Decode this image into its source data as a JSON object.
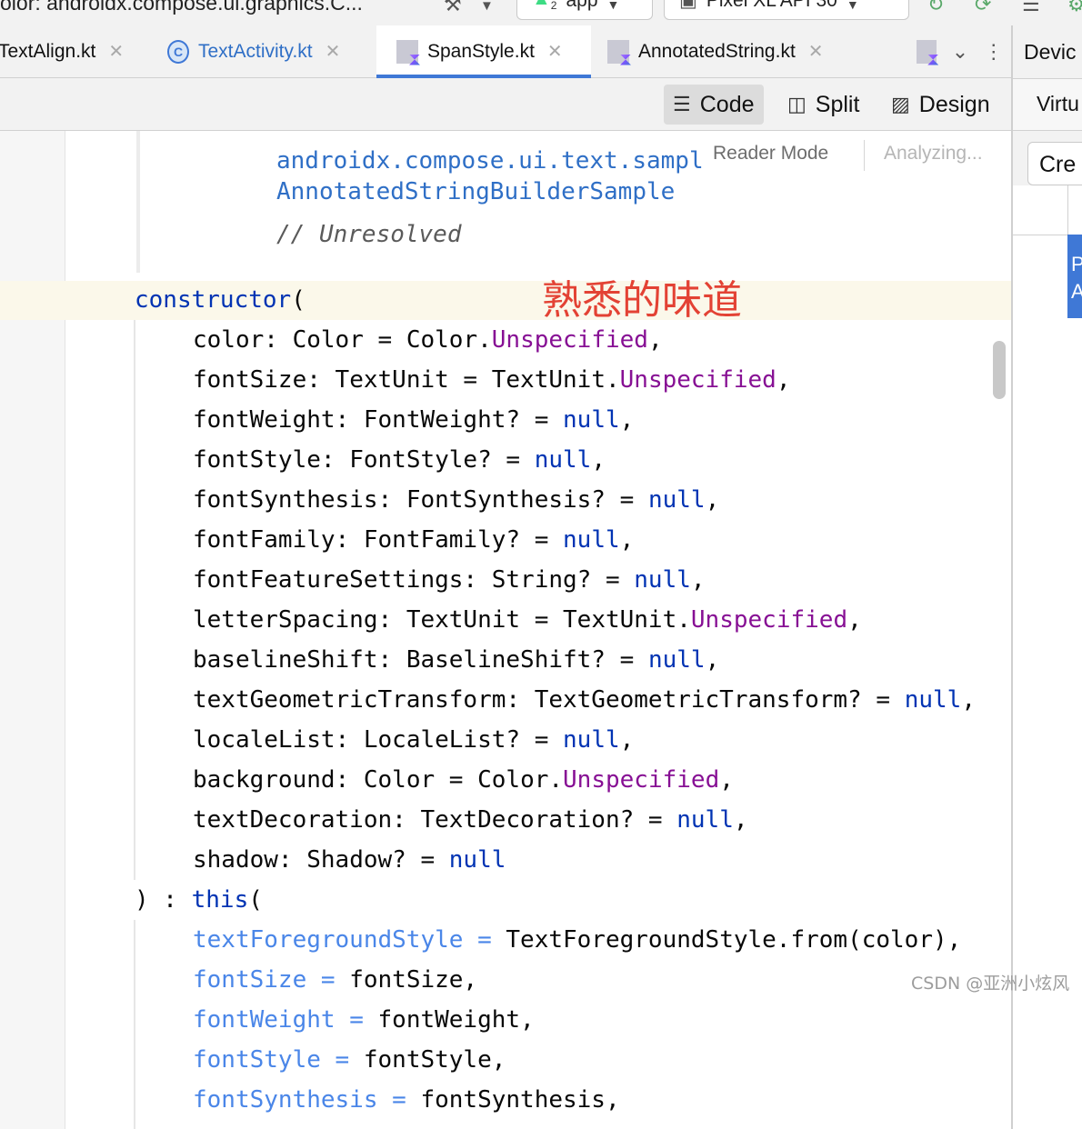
{
  "toolbar": {
    "breadcrumb": "olor: androidx.compose.ui.graphics.C...",
    "run_config": "app",
    "device": "Pixel XL API 30",
    "badge_count": "2"
  },
  "tabs": [
    {
      "label": "TextAlign.kt",
      "type": "kotlin-file",
      "active": false
    },
    {
      "label": "TextActivity.kt",
      "type": "kotlin-class",
      "active": false
    },
    {
      "label": "SpanStyle.kt",
      "type": "kotlin-file",
      "active": true
    },
    {
      "label": "AnnotatedString.kt",
      "type": "kotlin-file",
      "active": false
    }
  ],
  "view_modes": {
    "code": "Code",
    "split": "Split",
    "design": "Design"
  },
  "right_panel": {
    "title": "Devic",
    "subtitle": "Virtu",
    "create": "Cre",
    "device_letters": [
      "P",
      "A"
    ]
  },
  "editor": {
    "reader_mode": "Reader Mode",
    "analyzing": "Analyzing...",
    "doc_link_1": "androidx.compose.ui.text.sampl",
    "doc_link_2": "AnnotatedStringBuilderSample",
    "doc_comment": "// Unresolved",
    "annotation": "熟悉的味道",
    "constructor_kw": "constructor",
    "params": [
      {
        "name": "color",
        "type": "Color",
        "default_prefix": "Color.",
        "default_value": "Unspecified",
        "kind": "prop",
        "suffix": ","
      },
      {
        "name": "fontSize",
        "type": "TextUnit",
        "default_prefix": "TextUnit.",
        "default_value": "Unspecified",
        "kind": "prop",
        "suffix": ","
      },
      {
        "name": "fontWeight",
        "type": "FontWeight?",
        "default_prefix": "",
        "default_value": "null",
        "kind": "kw",
        "suffix": ","
      },
      {
        "name": "fontStyle",
        "type": "FontStyle?",
        "default_prefix": "",
        "default_value": "null",
        "kind": "kw",
        "suffix": ","
      },
      {
        "name": "fontSynthesis",
        "type": "FontSynthesis?",
        "default_prefix": "",
        "default_value": "null",
        "kind": "kw",
        "suffix": ","
      },
      {
        "name": "fontFamily",
        "type": "FontFamily?",
        "default_prefix": "",
        "default_value": "null",
        "kind": "kw",
        "suffix": ","
      },
      {
        "name": "fontFeatureSettings",
        "type": "String?",
        "default_prefix": "",
        "default_value": "null",
        "kind": "kw",
        "suffix": ","
      },
      {
        "name": "letterSpacing",
        "type": "TextUnit",
        "default_prefix": "TextUnit.",
        "default_value": "Unspecified",
        "kind": "prop",
        "suffix": ","
      },
      {
        "name": "baselineShift",
        "type": "BaselineShift?",
        "default_prefix": "",
        "default_value": "null",
        "kind": "kw",
        "suffix": ","
      },
      {
        "name": "textGeometricTransform",
        "type": "TextGeometricTransform?",
        "default_prefix": "",
        "default_value": "null",
        "kind": "kw",
        "suffix": ","
      },
      {
        "name": "localeList",
        "type": "LocaleList?",
        "default_prefix": "",
        "default_value": "null",
        "kind": "kw",
        "suffix": ","
      },
      {
        "name": "background",
        "type": "Color",
        "default_prefix": "Color.",
        "default_value": "Unspecified",
        "kind": "prop",
        "suffix": ","
      },
      {
        "name": "textDecoration",
        "type": "TextDecoration?",
        "default_prefix": "",
        "default_value": "null",
        "kind": "kw",
        "suffix": ","
      },
      {
        "name": "shadow",
        "type": "Shadow?",
        "default_prefix": "",
        "default_value": "null",
        "kind": "kw",
        "suffix": ""
      }
    ],
    "this_line_prefix": ") : ",
    "this_kw": "this",
    "this_paren": "(",
    "args": [
      {
        "name": "textForegroundStyle",
        "value": "TextForegroundStyle.from(color),"
      },
      {
        "name": "fontSize",
        "value": "fontSize,"
      },
      {
        "name": "fontWeight",
        "value": "fontWeight,"
      },
      {
        "name": "fontStyle",
        "value": "fontStyle,"
      },
      {
        "name": "fontSynthesis",
        "value": "fontSynthesis,"
      }
    ]
  },
  "watermark": "CSDN @亚洲小炫风"
}
